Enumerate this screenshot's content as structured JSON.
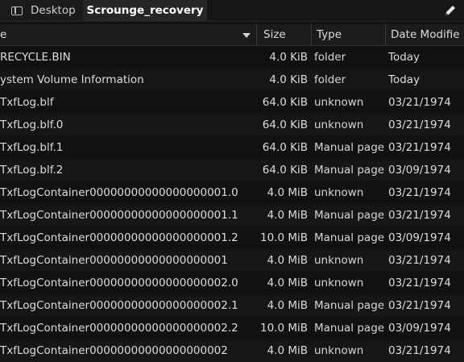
{
  "tabs": [
    {
      "label": "Desktop",
      "icon": "desktop-icon"
    },
    {
      "label": "Scrounge_recovery",
      "active": true
    }
  ],
  "toolbar": {
    "edit_icon": "pencil-icon"
  },
  "columns": {
    "name": "e",
    "size": "Size",
    "type": "Type",
    "date": "Date Modifie"
  },
  "rows": [
    {
      "name": "RECYCLE.BIN",
      "size": "4.0 KiB",
      "type": "folder",
      "date": "Today"
    },
    {
      "name": "ystem Volume Information",
      "size": "4.0 KiB",
      "type": "folder",
      "date": "Today"
    },
    {
      "name": "TxfLog.blf",
      "size": "64.0 KiB",
      "type": "unknown",
      "date": "03/21/1974"
    },
    {
      "name": "TxfLog.blf.0",
      "size": "64.0 KiB",
      "type": "unknown",
      "date": "03/21/1974"
    },
    {
      "name": "TxfLog.blf.1",
      "size": "64.0 KiB",
      "type": "Manual page",
      "date": "03/21/1974"
    },
    {
      "name": "TxfLog.blf.2",
      "size": "64.0 KiB",
      "type": "Manual page",
      "date": "03/09/1974"
    },
    {
      "name": "TxfLogContainer00000000000000000001.0",
      "size": "4.0 MiB",
      "type": "unknown",
      "date": "03/21/1974"
    },
    {
      "name": "TxfLogContainer00000000000000000001.1",
      "size": "4.0 MiB",
      "type": "Manual page",
      "date": "03/21/1974"
    },
    {
      "name": "TxfLogContainer00000000000000000001.2",
      "size": "10.0 MiB",
      "type": "Manual page",
      "date": "03/09/1974"
    },
    {
      "name": "TxfLogContainer00000000000000000001",
      "size": "4.0 MiB",
      "type": "unknown",
      "date": "03/21/1974"
    },
    {
      "name": "TxfLogContainer00000000000000000002.0",
      "size": "4.0 MiB",
      "type": "unknown",
      "date": "03/21/1974"
    },
    {
      "name": "TxfLogContainer00000000000000000002.1",
      "size": "4.0 MiB",
      "type": "Manual page",
      "date": "03/21/1974"
    },
    {
      "name": "TxfLogContainer00000000000000000002.2",
      "size": "10.0 MiB",
      "type": "Manual page",
      "date": "03/09/1974"
    },
    {
      "name": "TxfLogContainer00000000000000000002",
      "size": "4.0 MiB",
      "type": "unknown",
      "date": "03/21/1974"
    }
  ]
}
